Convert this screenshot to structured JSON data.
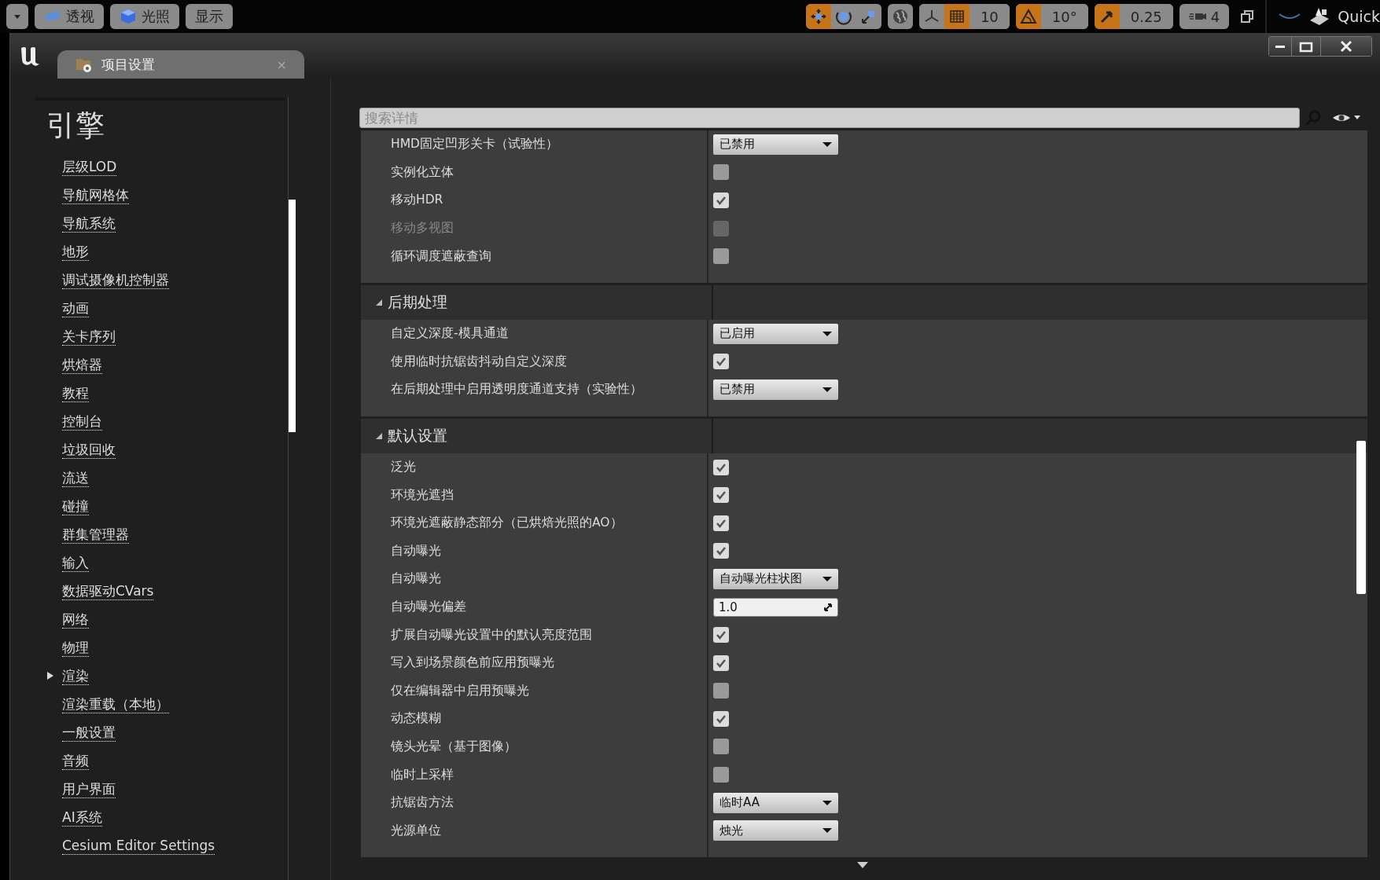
{
  "viewport_toolbar": {
    "view_buttons": [
      "透视",
      "光照",
      "显示"
    ],
    "transform_modes": [
      {
        "selected": true
      },
      {
        "selected": false
      },
      {
        "selected": false
      }
    ],
    "snaps": [
      {
        "value": "10",
        "on": true
      },
      {
        "value": "10°",
        "on": true
      },
      {
        "value": "0.25",
        "on": true
      }
    ],
    "camera_speed": "4",
    "quick_label": "Quick"
  },
  "window": {
    "tab": {
      "title": "项目设置",
      "close": "×"
    }
  },
  "sidebar": {
    "heading": "引擎",
    "items": [
      {
        "label": "层级LOD",
        "expandable": false
      },
      {
        "label": "导航网格体",
        "expandable": false
      },
      {
        "label": "导航系统",
        "expandable": false
      },
      {
        "label": "地形",
        "expandable": false
      },
      {
        "label": "调试摄像机控制器",
        "expandable": false
      },
      {
        "label": "动画",
        "expandable": false
      },
      {
        "label": "关卡序列",
        "expandable": false
      },
      {
        "label": "烘焙器",
        "expandable": false
      },
      {
        "label": "教程",
        "expandable": false
      },
      {
        "label": "控制台",
        "expandable": false
      },
      {
        "label": "垃圾回收",
        "expandable": false
      },
      {
        "label": "流送",
        "expandable": false
      },
      {
        "label": "碰撞",
        "expandable": false
      },
      {
        "label": "群集管理器",
        "expandable": false
      },
      {
        "label": "输入",
        "expandable": false
      },
      {
        "label": "数据驱动CVars",
        "expandable": false
      },
      {
        "label": "网络",
        "expandable": false
      },
      {
        "label": "物理",
        "expandable": false
      },
      {
        "label": "渲染",
        "expandable": true
      },
      {
        "label": "渲染重载（本地）",
        "expandable": false
      },
      {
        "label": "一般设置",
        "expandable": false
      },
      {
        "label": "音频",
        "expandable": false
      },
      {
        "label": "用户界面",
        "expandable": false
      },
      {
        "label": "AI系统",
        "expandable": false
      },
      {
        "label": "Cesium Editor Settings",
        "expandable": false
      }
    ]
  },
  "details": {
    "search": {
      "placeholder": "搜索详情"
    },
    "sections": [
      {
        "rows": [
          {
            "kind": "dropdown",
            "label": "HMD固定凹形关卡（试验性）",
            "value": "已禁用",
            "disabled": false
          },
          {
            "kind": "checkbox",
            "label": "实例化立体",
            "checked": false,
            "disabled": false
          },
          {
            "kind": "checkbox",
            "label": "移动HDR",
            "checked": true,
            "disabled": false
          },
          {
            "kind": "checkbox",
            "label": "移动多视图",
            "checked": false,
            "disabled": true
          },
          {
            "kind": "checkbox",
            "label": "循环调度遮蔽查询",
            "checked": false,
            "disabled": false
          }
        ]
      },
      {
        "title": "后期处理",
        "expanded": true,
        "rows": [
          {
            "kind": "dropdown",
            "label": "自定义深度-模具通道",
            "value": "已启用",
            "disabled": false
          },
          {
            "kind": "checkbox",
            "label": "使用临时抗锯齿抖动自定义深度",
            "checked": true,
            "disabled": false
          },
          {
            "kind": "dropdown",
            "label": "在后期处理中启用透明度通道支持（实验性）",
            "value": "已禁用",
            "disabled": false
          }
        ]
      },
      {
        "title": "默认设置",
        "expanded": true,
        "rows": [
          {
            "kind": "checkbox",
            "label": "泛光",
            "checked": true,
            "disabled": false
          },
          {
            "kind": "checkbox",
            "label": "环境光遮挡",
            "checked": true,
            "disabled": false
          },
          {
            "kind": "checkbox",
            "label": "环境光遮蔽静态部分（已烘焙光照的AO）",
            "checked": true,
            "disabled": false
          },
          {
            "kind": "checkbox",
            "label": "自动曝光",
            "checked": true,
            "disabled": false
          },
          {
            "kind": "dropdown",
            "label": "自动曝光",
            "value": "自动曝光柱状图",
            "disabled": false
          },
          {
            "kind": "number",
            "label": "自动曝光偏差",
            "value": "1.0",
            "disabled": false
          },
          {
            "kind": "checkbox",
            "label": "扩展自动曝光设置中的默认亮度范围",
            "checked": true,
            "disabled": false
          },
          {
            "kind": "checkbox",
            "label": "写入到场景颜色前应用预曝光",
            "checked": true,
            "disabled": false
          },
          {
            "kind": "checkbox",
            "label": "仅在编辑器中启用预曝光",
            "checked": false,
            "disabled": false
          },
          {
            "kind": "checkbox",
            "label": "动态模糊",
            "checked": true,
            "disabled": false
          },
          {
            "kind": "checkbox",
            "label": "镜头光晕（基于图像）",
            "checked": false,
            "disabled": false
          },
          {
            "kind": "checkbox",
            "label": "临时上采样",
            "checked": false,
            "disabled": false
          },
          {
            "kind": "dropdown",
            "label": "抗锯齿方法",
            "value": "临时AA",
            "disabled": false
          },
          {
            "kind": "dropdown",
            "label": "光源单位",
            "value": "烛光",
            "disabled": false
          }
        ]
      }
    ]
  }
}
